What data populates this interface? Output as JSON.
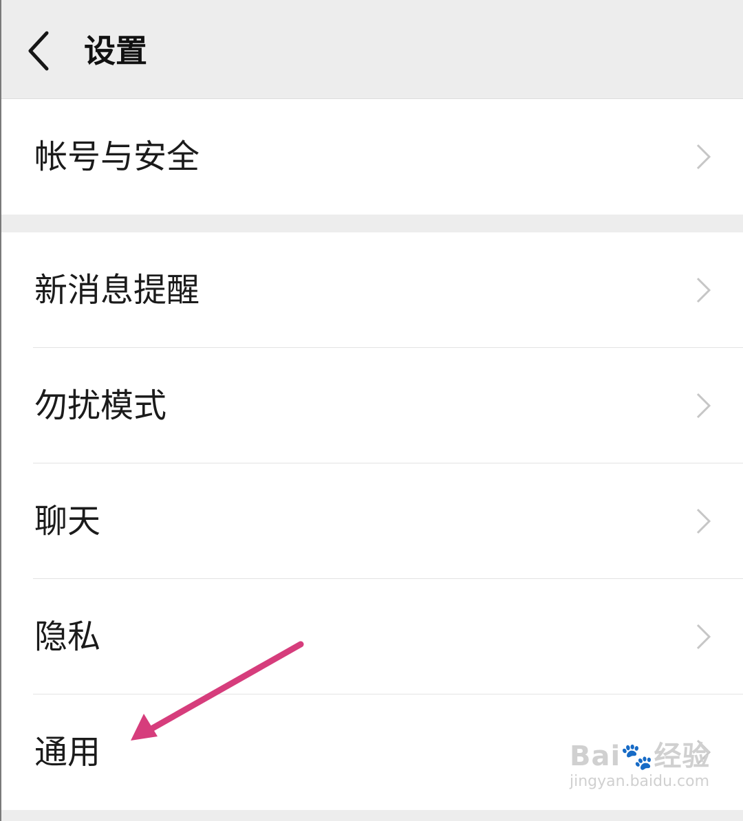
{
  "header": {
    "title": "设置",
    "back_icon": "chevron-left-icon"
  },
  "groups": [
    {
      "items": [
        {
          "label": "帐号与安全"
        }
      ]
    },
    {
      "items": [
        {
          "label": "新消息提醒"
        },
        {
          "label": "勿扰模式"
        },
        {
          "label": "聊天"
        },
        {
          "label": "隐私"
        },
        {
          "label": "通用"
        }
      ]
    }
  ],
  "annotation": {
    "arrow_color": "#d63d7c",
    "target": "通用"
  },
  "watermark": {
    "brand": "Bai",
    "brand_suffix": "经验",
    "url": "jingyan.baidu.com"
  },
  "colors": {
    "background": "#ededed",
    "row_background": "#ffffff",
    "text": "#1b1b1b",
    "chevron": "#c6c6c6"
  }
}
